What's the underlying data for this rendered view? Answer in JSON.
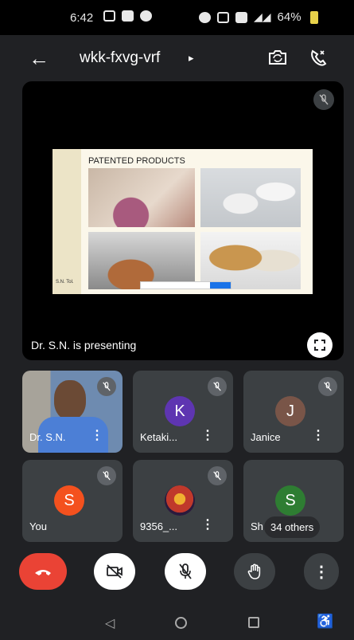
{
  "status_bar": {
    "time": "6:42",
    "battery_percent": "64%"
  },
  "top_bar": {
    "meeting_code": "wkk-fxvg-vrf",
    "caret": "▸"
  },
  "presentation": {
    "slide_title": "PATENTED PRODUCTS",
    "slide_author": "S.N. Tol.",
    "presenting_label": "Dr. S.N. is presenting"
  },
  "participants": [
    {
      "name": "Dr. S.N.",
      "type": "video"
    },
    {
      "name": "Ketaki...",
      "initial": "K",
      "avatar_color": "#5e35b1"
    },
    {
      "name": "Janice",
      "initial": "J",
      "avatar_color": "#795548"
    },
    {
      "name": "You",
      "initial": "S",
      "avatar_color": "#f4511e"
    },
    {
      "name": "9356_...",
      "type": "image"
    },
    {
      "name": "Sh",
      "initial": "S",
      "avatar_color": "#2e7d32",
      "others_label": "34 others"
    }
  ],
  "colors": {
    "end_call": "#ea4335",
    "tile": "#3c4043",
    "background": "#202124"
  }
}
